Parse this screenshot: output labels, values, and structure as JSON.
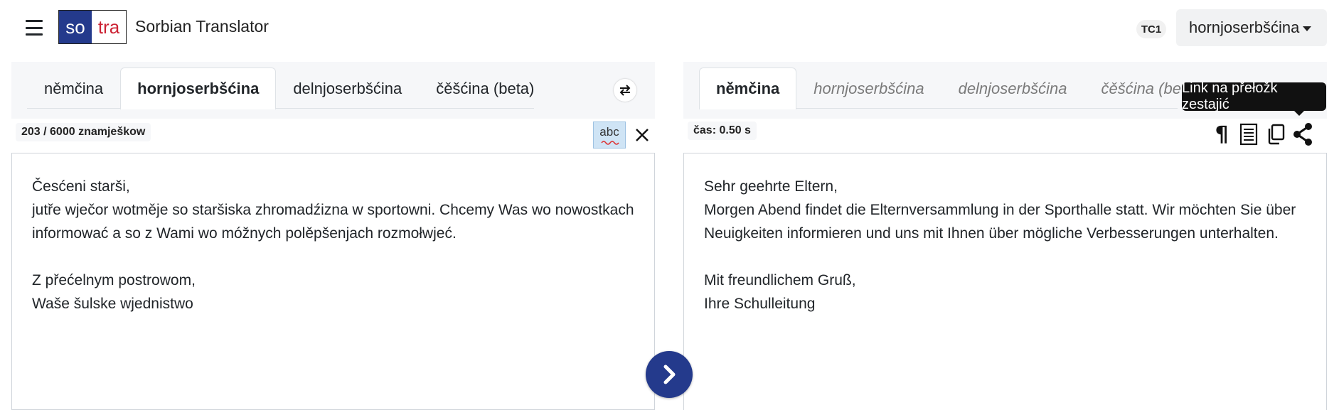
{
  "header": {
    "logo_so": "so",
    "logo_tra": "tra",
    "title": "Sorbian Translator",
    "badge": "TC1",
    "language_select": "hornjoserbšćina"
  },
  "source": {
    "tabs": [
      {
        "label": "němčina",
        "active": false
      },
      {
        "label": "hornjoserbšćina",
        "active": true
      },
      {
        "label": "delnjoserbšćina",
        "active": false
      },
      {
        "label": "čěšćina (beta)",
        "active": false
      }
    ],
    "char_count": "203 / 6000 znamješkow",
    "spellcheck_label": "abc",
    "text": "Česćeni starši,\njutře wječor wotměje so staršiska zhromadźizna w sportowni. Chcemy Was wo nowostkach informować a so z Wami wo móžnych polěpšenjach rozmołwjeć.\n\nZ přećelnym postrowom,\nWaše šulske wjednistwo"
  },
  "target": {
    "tabs": [
      {
        "label": "němčina",
        "active": true
      },
      {
        "label": "hornjoserbšćina",
        "active": false
      },
      {
        "label": "delnjoserbšćina",
        "active": false
      },
      {
        "label": "čěšćina (beta)",
        "active": false
      }
    ],
    "time": "čas: 0.50 s",
    "pilcrow": "¶",
    "tooltip": "Link na přełožk zestajić",
    "text": "Sehr geehrte Eltern,\nMorgen Abend findet die Elternversammlung in der Sporthalle statt. Wir möchten Sie über Neuigkeiten informieren und uns mit Ihnen über mögliche Verbesserungen unterhalten.\n\nMit freundlichem Gruß,\nIhre Schulleitung"
  },
  "colors": {
    "brand_blue": "#243a8c",
    "brand_red": "#cc2233",
    "spell_bg": "#cfe4f5"
  }
}
